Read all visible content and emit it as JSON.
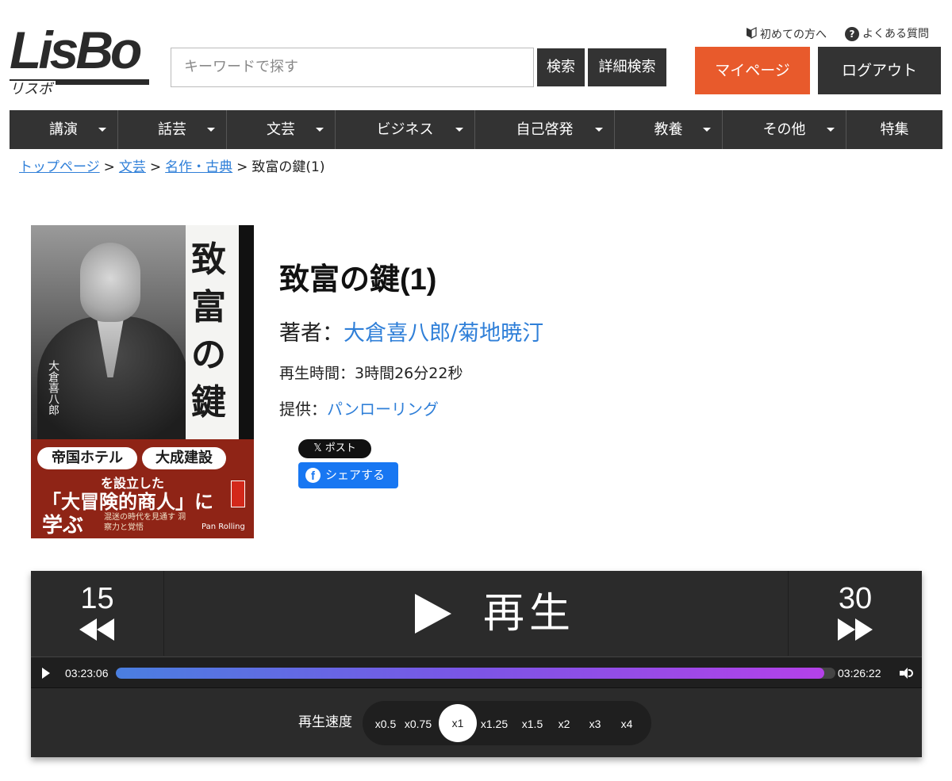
{
  "header": {
    "logo_text": "LisBo",
    "logo_sub": "リスボ",
    "search_placeholder": "キーワードで探す",
    "search_button": "検索",
    "advanced_search_button": "詳細検索",
    "first_time_link": "初めての方へ",
    "faq_link": "よくある質問",
    "mypage_button": "マイページ",
    "logout_button": "ログアウト"
  },
  "nav": {
    "items": [
      {
        "label": "講演",
        "dropdown": true
      },
      {
        "label": "話芸",
        "dropdown": true
      },
      {
        "label": "文芸",
        "dropdown": true
      },
      {
        "label": "ビジネス",
        "dropdown": true
      },
      {
        "label": "自己啓発",
        "dropdown": true
      },
      {
        "label": "教養",
        "dropdown": true
      },
      {
        "label": "その他",
        "dropdown": true
      },
      {
        "label": "特集",
        "dropdown": false
      }
    ]
  },
  "breadcrumb": {
    "items": [
      "トップページ",
      "文芸",
      "名作・古典"
    ],
    "separator": ">",
    "current": "致富の鍵(1)"
  },
  "cover": {
    "title_vertical": "致富の鍵",
    "author_vertical": "大倉喜八郎",
    "pill1": "帝国ホテル",
    "pill2": "大成建設",
    "line2": "を設立した",
    "line3": "「大冒険的商人」に",
    "line4": "学ぶ",
    "small_text": "混迷の時代を見通す 洞察力と覚悟",
    "brand": "Pan Rolling"
  },
  "product": {
    "title": "致富の鍵(1)",
    "author_label": "著者：",
    "author": "大倉喜八郎/菊地暁汀",
    "duration": "再生時間：3時間26分22秒",
    "provider_label": "提供：",
    "provider": "パンローリング"
  },
  "social": {
    "x_button": "𝕏 ポスト",
    "fb_button": "シェアする"
  },
  "player": {
    "skip_back_seconds": "15",
    "skip_forward_seconds": "30",
    "play_label": "再生",
    "current_time": "03:23:06",
    "total_time": "03:26:22",
    "progress_fraction": 0.985,
    "speed_label": "再生速度",
    "speed_options": [
      "x0.5",
      "x0.75",
      "x1",
      "x1.25",
      "x1.5",
      "x2",
      "x3",
      "x4"
    ],
    "selected_speed": "x1"
  },
  "colors": {
    "accent_orange": "#e85a2c",
    "dark": "#333333",
    "link_blue": "#2f7fd8",
    "progress_start": "#4a7fe0",
    "progress_end": "#b441e8"
  }
}
